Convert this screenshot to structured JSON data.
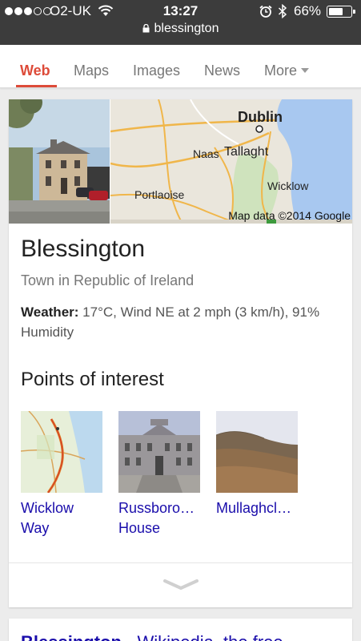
{
  "status_bar": {
    "carrier": "O2-UK",
    "time": "13:27",
    "battery_percent": "66%",
    "battery_level": 0.66,
    "url": "blessington"
  },
  "tabs": [
    {
      "label": "Web",
      "active": true
    },
    {
      "label": "Maps",
      "active": false
    },
    {
      "label": "Images",
      "active": false
    },
    {
      "label": "News",
      "active": false
    },
    {
      "label": "More",
      "active": false
    }
  ],
  "card": {
    "map_labels": {
      "dublin": "Dublin",
      "naas": "Naas",
      "tallaght": "Tallaght",
      "wicklow": "Wicklow",
      "portlaoise": "Portlaoise"
    },
    "map_credit": "Map data ©2014 Google",
    "title": "Blessington",
    "subtitle": "Town in Republic of Ireland",
    "weather_label": "Weather:",
    "weather_value": " 17°C, Wind NE at 2 mph (3 km/h), 91% Humidity",
    "poi_heading": "Points of interest",
    "poi": [
      {
        "label_line1": "Wicklow",
        "label_line2": "Way"
      },
      {
        "label_line1": "Russboro…",
        "label_line2": "House"
      },
      {
        "label_line1": "Mullaghcl…",
        "label_line2": ""
      }
    ]
  },
  "next_result": {
    "title_bold": "Blessington",
    "title_rest": " - Wikipedia, the free"
  },
  "colors": {
    "accent_red": "#dd4b39",
    "link_blue": "#1a0dab",
    "status_bar": "#3c3c3c"
  }
}
